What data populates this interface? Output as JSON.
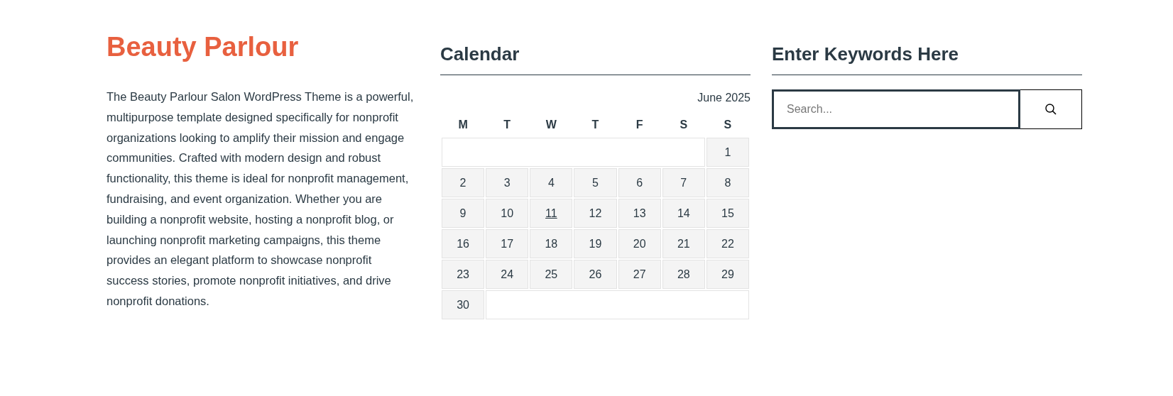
{
  "about": {
    "title": "Beauty Parlour",
    "text": "The Beauty Parlour Salon WordPress Theme is a powerful, multipurpose template designed specifically for nonprofit organizations looking to amplify their mission and engage communities. Crafted with modern design and robust functionality, this theme is ideal for nonprofit management, fundraising, and event organization. Whether you are building a nonprofit website, hosting a nonprofit blog, or launching nonprofit marketing campaigns, this theme provides an elegant platform to showcase nonprofit success stories, promote nonprofit initiatives, and drive nonprofit donations."
  },
  "calendar": {
    "title": "Calendar",
    "caption": "June 2025",
    "weekdays": [
      "M",
      "T",
      "W",
      "T",
      "F",
      "S",
      "S"
    ],
    "weeks": [
      {
        "kind": "lead",
        "days": [
          {
            "day": "1",
            "today": false
          }
        ]
      },
      {
        "kind": "full",
        "days": [
          {
            "day": "2",
            "today": false
          },
          {
            "day": "3",
            "today": false
          },
          {
            "day": "4",
            "today": false
          },
          {
            "day": "5",
            "today": false
          },
          {
            "day": "6",
            "today": false
          },
          {
            "day": "7",
            "today": false
          },
          {
            "day": "8",
            "today": false
          }
        ]
      },
      {
        "kind": "full",
        "days": [
          {
            "day": "9",
            "today": false
          },
          {
            "day": "10",
            "today": false
          },
          {
            "day": "11",
            "today": true
          },
          {
            "day": "12",
            "today": false
          },
          {
            "day": "13",
            "today": false
          },
          {
            "day": "14",
            "today": false
          },
          {
            "day": "15",
            "today": false
          }
        ]
      },
      {
        "kind": "full",
        "days": [
          {
            "day": "16",
            "today": false
          },
          {
            "day": "17",
            "today": false
          },
          {
            "day": "18",
            "today": false
          },
          {
            "day": "19",
            "today": false
          },
          {
            "day": "20",
            "today": false
          },
          {
            "day": "21",
            "today": false
          },
          {
            "day": "22",
            "today": false
          }
        ]
      },
      {
        "kind": "full",
        "days": [
          {
            "day": "23",
            "today": false
          },
          {
            "day": "24",
            "today": false
          },
          {
            "day": "25",
            "today": false
          },
          {
            "day": "26",
            "today": false
          },
          {
            "day": "27",
            "today": false
          },
          {
            "day": "28",
            "today": false
          },
          {
            "day": "29",
            "today": false
          }
        ]
      },
      {
        "kind": "trail",
        "days": [
          {
            "day": "30",
            "today": false
          }
        ]
      }
    ]
  },
  "search": {
    "title": "Enter Keywords Here",
    "placeholder": "Search..."
  }
}
